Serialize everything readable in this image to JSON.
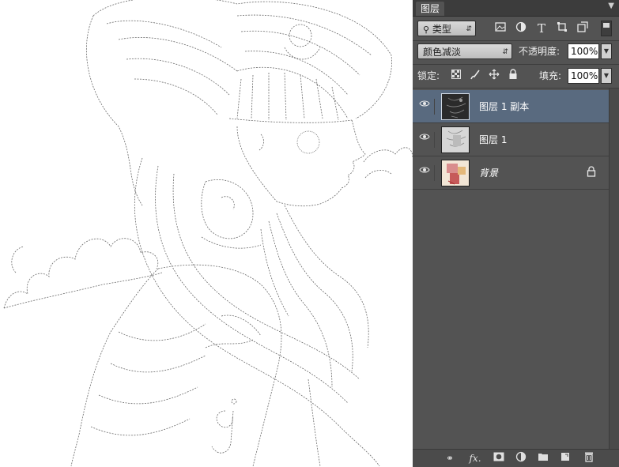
{
  "canvas": {
    "artwork_name": "line-art-portrait"
  },
  "panel": {
    "tab_label": "图层",
    "menu_icon": "panel-menu-icon",
    "filter": {
      "kind_label": "类型",
      "icons": [
        "image-filter-icon",
        "adjustment-filter-icon",
        "type-filter-icon",
        "shape-filter-icon",
        "smart-object-filter-icon"
      ]
    },
    "blend_mode": "颜色减淡",
    "opacity_label": "不透明度:",
    "opacity_value": "100%",
    "lock_label": "锁定:",
    "fill_label": "填充:",
    "fill_value": "100%",
    "layers": [
      {
        "name": "图层 1 副本",
        "selected": true,
        "visible": true,
        "locked": false
      },
      {
        "name": "图层 1",
        "selected": false,
        "visible": true,
        "locked": false
      },
      {
        "name": "背景",
        "selected": false,
        "visible": true,
        "locked": true
      }
    ],
    "bottom_icons": [
      "link-layers-icon",
      "fx-icon",
      "add-mask-icon",
      "adjustment-layer-icon",
      "new-group-icon",
      "new-layer-icon",
      "delete-layer-icon"
    ],
    "colors": {
      "panel_bg": "#535353",
      "selected_row": "#596a7f"
    }
  }
}
